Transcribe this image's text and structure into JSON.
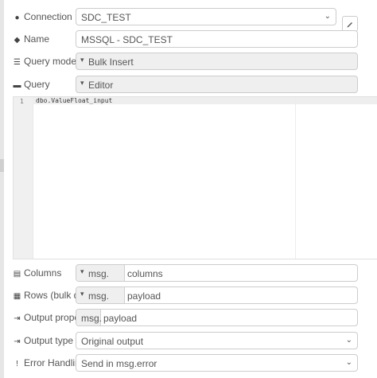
{
  "connection": {
    "label": "Connection",
    "icon": "globe-icon",
    "value": "SDC_TEST"
  },
  "name": {
    "label": "Name",
    "icon": "tag-icon",
    "value": "MSSQL - SDC_TEST"
  },
  "query_mode": {
    "label": "Query mode",
    "icon": "list-icon",
    "value": "Bulk Insert"
  },
  "query": {
    "label": "Query",
    "icon": "comments-icon",
    "value": "Editor"
  },
  "editor": {
    "line_number": "1",
    "code": "dbo.ValueFloat_input"
  },
  "columns": {
    "label": "Columns",
    "icon": "table-icon",
    "prefix": "msg.",
    "value": "columns"
  },
  "rows": {
    "label": "Rows (bulk data)",
    "icon": "table-icon",
    "prefix": "msg.",
    "value": "payload"
  },
  "output_property": {
    "label": "Output property",
    "icon": "sign-out-icon",
    "prefix": "msg.",
    "value": "payload"
  },
  "output_type": {
    "label": "Output type",
    "icon": "sign-out-icon",
    "value": "Original output"
  },
  "error_handling": {
    "label": "Error Handling",
    "icon": "exclamation-icon",
    "value": "Send in msg.error"
  }
}
